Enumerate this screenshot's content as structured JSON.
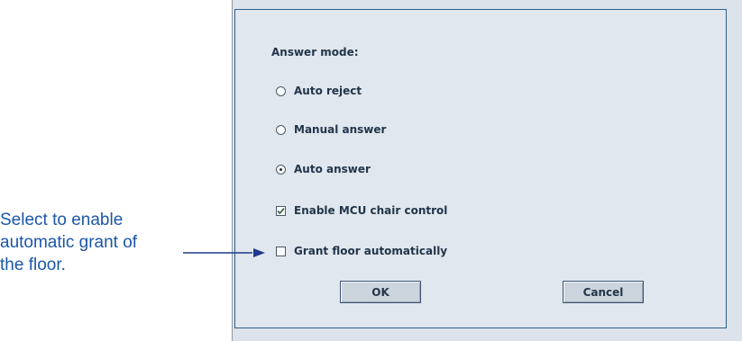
{
  "callout": {
    "line1": "Select to enable",
    "line2": "automatic grant of",
    "line3": "the floor."
  },
  "dialog": {
    "answer_mode_label": "Answer mode:",
    "radios": [
      {
        "label": "Auto reject",
        "checked": false
      },
      {
        "label": "Manual answer",
        "checked": false
      },
      {
        "label": "Auto answer",
        "checked": true
      }
    ],
    "checkboxes": [
      {
        "label": "Enable MCU chair control",
        "checked": true
      },
      {
        "label": "Grant floor automatically",
        "checked": false
      }
    ],
    "ok_label": "OK",
    "cancel_label": "Cancel"
  },
  "colors": {
    "callout_text": "#1a56a8",
    "arrow": "#1e3a8a",
    "dialog_bg": "#e1e7ee",
    "dialog_border": "#2f5f8c"
  }
}
